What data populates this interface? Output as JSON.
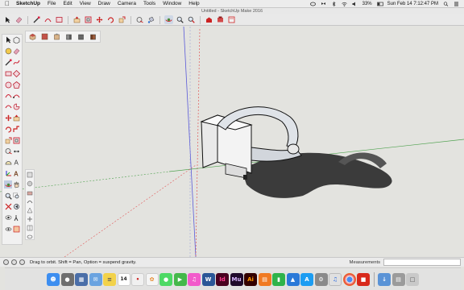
{
  "menubar": {
    "apple_icon": "apple-icon",
    "app_name": "SketchUp",
    "items": [
      "File",
      "Edit",
      "View",
      "Draw",
      "Camera",
      "Tools",
      "Window",
      "Help"
    ],
    "battery": "33%",
    "clock": "Sun Feb 14  7:12:47 PM"
  },
  "window": {
    "title": "Untitled - SketchUp Make 2016"
  },
  "toolbar": {
    "icons": [
      "select-icon",
      "eraser-icon",
      "line-icon",
      "arc-icon",
      "shape-icon",
      "push-pull-icon",
      "offset-icon",
      "move-icon",
      "rotate-icon",
      "scale-icon",
      "tape-measure-icon",
      "paint-bucket-icon",
      "orbit-icon",
      "zoom-icon",
      "zoom-extents-icon",
      "warehouse-icon",
      "extension-icon",
      "layout-icon"
    ]
  },
  "views_toolbar": {
    "icons": [
      "iso-view-icon",
      "top-view-icon",
      "front-view-icon",
      "right-view-icon",
      "back-view-icon",
      "left-view-icon"
    ]
  },
  "statusbar": {
    "message": "Drag to orbit. Shift = Pan, Option = suspend gravity.",
    "measurements_label": "Measurements",
    "measurements_value": ""
  },
  "dock": {
    "calendar_day": "14",
    "apps": [
      {
        "name": "finder",
        "color": "#3d8ef0",
        "label": ""
      },
      {
        "name": "launchpad",
        "color": "#6e6e6e",
        "label": ""
      },
      {
        "name": "mission-control",
        "color": "#4a6ea8",
        "label": ""
      },
      {
        "name": "mail",
        "color": "#6aa3e0",
        "label": ""
      },
      {
        "name": "notes",
        "color": "#f2d24b",
        "label": ""
      },
      {
        "name": "calendar",
        "color": "#ffffff",
        "label": "14"
      },
      {
        "name": "reminders",
        "color": "#f0f0f0",
        "label": ""
      },
      {
        "name": "photos",
        "color": "#f5f5f5",
        "label": ""
      },
      {
        "name": "messages",
        "color": "#4cd964",
        "label": ""
      },
      {
        "name": "facetime",
        "color": "#44b84a",
        "label": ""
      },
      {
        "name": "itunes",
        "color": "#f25acb",
        "label": ""
      },
      {
        "name": "word",
        "color": "#2b5797",
        "label": "W"
      },
      {
        "name": "indesign",
        "color": "#49021f",
        "label": "Id"
      },
      {
        "name": "muse",
        "color": "#1f0a2a",
        "label": "Mu"
      },
      {
        "name": "illustrator",
        "color": "#330000",
        "label": "Ai"
      },
      {
        "name": "ibooks",
        "color": "#f07a22",
        "label": ""
      },
      {
        "name": "numbers",
        "color": "#2eb34a",
        "label": ""
      },
      {
        "name": "keynote",
        "color": "#2a79d8",
        "label": ""
      },
      {
        "name": "app-store",
        "color": "#1c9df2",
        "label": "A"
      },
      {
        "name": "system-preferences",
        "color": "#8a8a8a",
        "label": ""
      },
      {
        "name": "itunes-2",
        "color": "#e0e0e0",
        "label": ""
      },
      {
        "name": "chrome",
        "color": "#f2f2f2",
        "label": ""
      },
      {
        "name": "sketchup",
        "color": "#d8291b",
        "label": ""
      }
    ],
    "right_items": [
      {
        "name": "downloads",
        "color": "#5a93d6"
      },
      {
        "name": "files-stack",
        "color": "#9b9b9b"
      },
      {
        "name": "trash",
        "color": "#c9c9c9"
      }
    ]
  },
  "colors": {
    "sky": "#e3e3df",
    "red_axis": "#e25a5a",
    "green_axis": "#4fa24f",
    "blue_axis": "#5a5ad8"
  }
}
